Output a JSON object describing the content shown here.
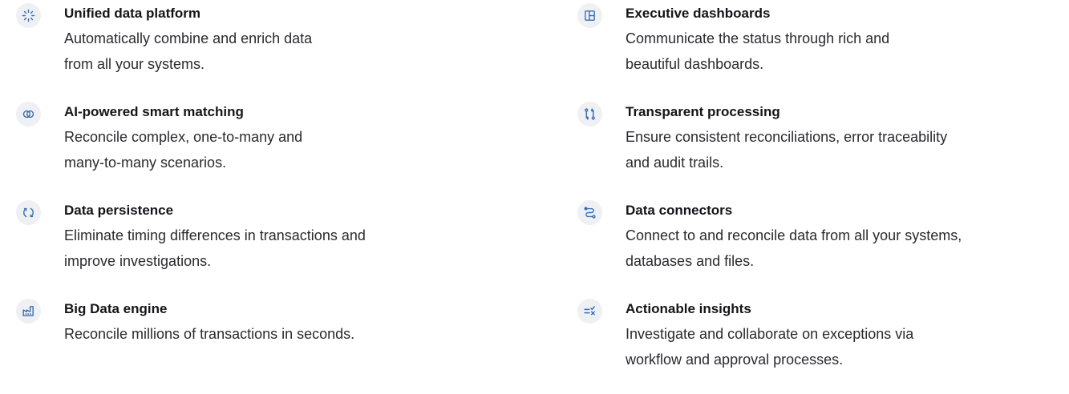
{
  "left_column": [
    {
      "icon": "sparkle-icon",
      "title": "Unified data platform",
      "desc_lines": [
        "Automatically combine and enrich data",
        "from all your systems."
      ]
    },
    {
      "icon": "overlap-circles-icon",
      "title": "AI-powered smart matching",
      "desc_lines": [
        "Reconcile complex, one-to-many and",
        "many-to-many scenarios."
      ]
    },
    {
      "icon": "refresh-icon",
      "title": "Data persistence",
      "desc_lines": [
        "Eliminate timing differences in transactions and",
        "improve investigations."
      ]
    },
    {
      "icon": "factory-icon",
      "title": "Big Data engine",
      "desc_lines": [
        "Reconcile millions of transactions in seconds."
      ]
    }
  ],
  "right_column": [
    {
      "icon": "layout-icon",
      "title": "Executive dashboards",
      "desc_lines": [
        "Communicate the status through rich and",
        "beautiful dashboards."
      ]
    },
    {
      "icon": "git-compare-icon",
      "title": "Transparent processing",
      "desc_lines": [
        "Ensure consistent reconciliations, error traceability",
        "and audit trails."
      ]
    },
    {
      "icon": "route-icon",
      "title": "Data connectors",
      "desc_lines": [
        "Connect to and reconcile data from all your systems,",
        "databases and files."
      ]
    },
    {
      "icon": "list-check-icon",
      "title": "Actionable insights",
      "desc_lines": [
        "Investigate and collaborate on exceptions via",
        "workflow and approval processes."
      ]
    }
  ],
  "colors": {
    "icon_accent": "#3b6fb6",
    "icon_bg": "#eef0f3"
  }
}
